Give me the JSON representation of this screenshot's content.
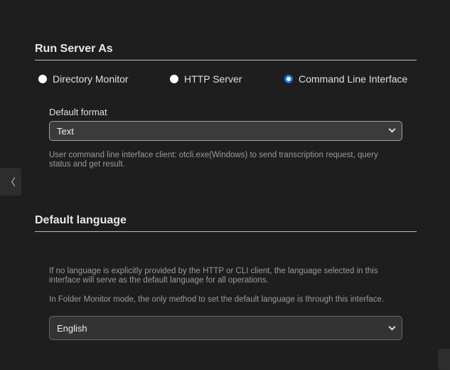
{
  "run_server": {
    "title": "Run Server As",
    "options": [
      {
        "label": "Directory Monitor",
        "selected": false
      },
      {
        "label": "HTTP Server",
        "selected": false
      },
      {
        "label": "Command Line Interface",
        "selected": true
      }
    ],
    "format_label": "Default format",
    "format_value": "Text",
    "help": "User command line interface client: otcli.exe(Windows) to send transcription request, query status and get result."
  },
  "language": {
    "title": "Default language",
    "help1": "If no language is explicitly provided by the HTTP or CLI client, the language selected in this interface will serve as the default language for all operations.",
    "help2": "In Folder Monitor mode, the only method to set the default language is through this interface.",
    "value": "English"
  },
  "side_tab": {
    "icon_text": "〈"
  }
}
